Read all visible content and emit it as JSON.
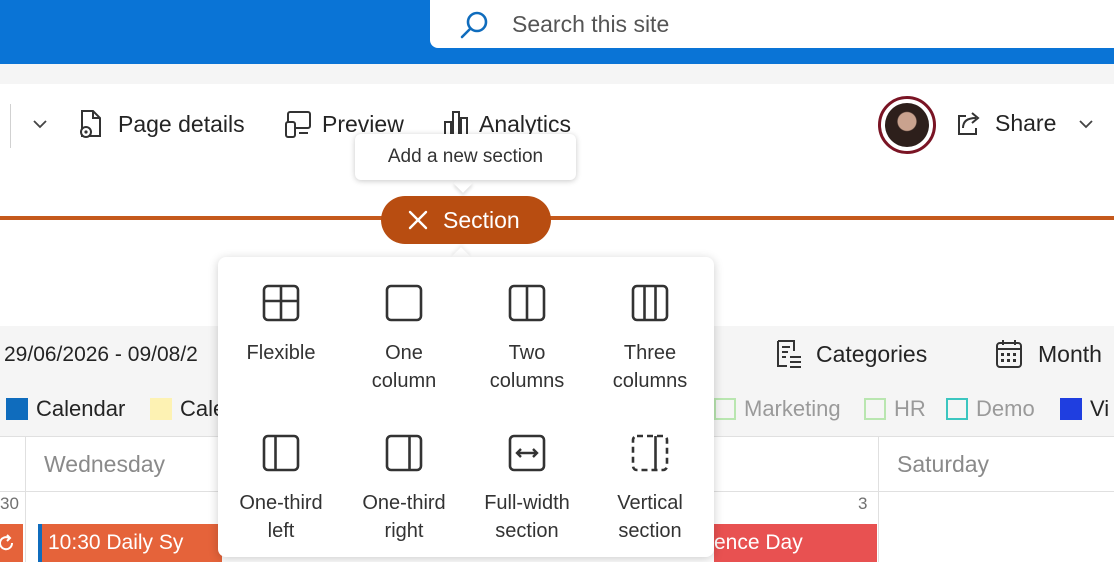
{
  "search": {
    "placeholder": "Search this site",
    "icon": "search-icon"
  },
  "toolbar": {
    "page_details": "Page details",
    "preview": "Preview",
    "analytics": "Analytics",
    "share": "Share"
  },
  "tooltip": {
    "text": "Add a new section"
  },
  "section_button": {
    "label": "Section"
  },
  "calendar": {
    "date_range": "29/06/2026 - 09/08/2",
    "categories_label": "Categories",
    "month_label": "Month",
    "legend": [
      {
        "label": "Calendar",
        "color": "#0f6cbd"
      },
      {
        "label": "Cale",
        "color": "#fdf2b3"
      },
      {
        "label": "Marketing",
        "color": "#b9e6b0"
      },
      {
        "label": "HR",
        "color": "#b9e6b0"
      },
      {
        "label": "Demo",
        "color": "#3cc6c0"
      },
      {
        "label": "Vi",
        "color": "#1f3ee0"
      }
    ],
    "days": {
      "wednesday": "Wednesday",
      "saturday": "Saturday"
    },
    "dates": {
      "d30": "30",
      "d3": "3"
    },
    "events": {
      "daily": "10:30 Daily Sy",
      "conference": "ence Day"
    }
  },
  "section_options": [
    {
      "label": "Flexible",
      "icon": "flexible-layout-icon"
    },
    {
      "label": "One\ncolumn",
      "icon": "one-column-icon"
    },
    {
      "label": "Two\ncolumns",
      "icon": "two-columns-icon"
    },
    {
      "label": "Three\ncolumns",
      "icon": "three-columns-icon"
    },
    {
      "label": "One-third\nleft",
      "icon": "one-third-left-icon"
    },
    {
      "label": "One-third\nright",
      "icon": "one-third-right-icon"
    },
    {
      "label": "Full-width\nsection",
      "icon": "full-width-icon"
    },
    {
      "label": "Vertical\nsection",
      "icon": "vertical-section-icon"
    }
  ],
  "colors": {
    "brand_blue": "#0a74d6",
    "accent_orange": "#b84d11",
    "line_orange": "#c5591c"
  }
}
